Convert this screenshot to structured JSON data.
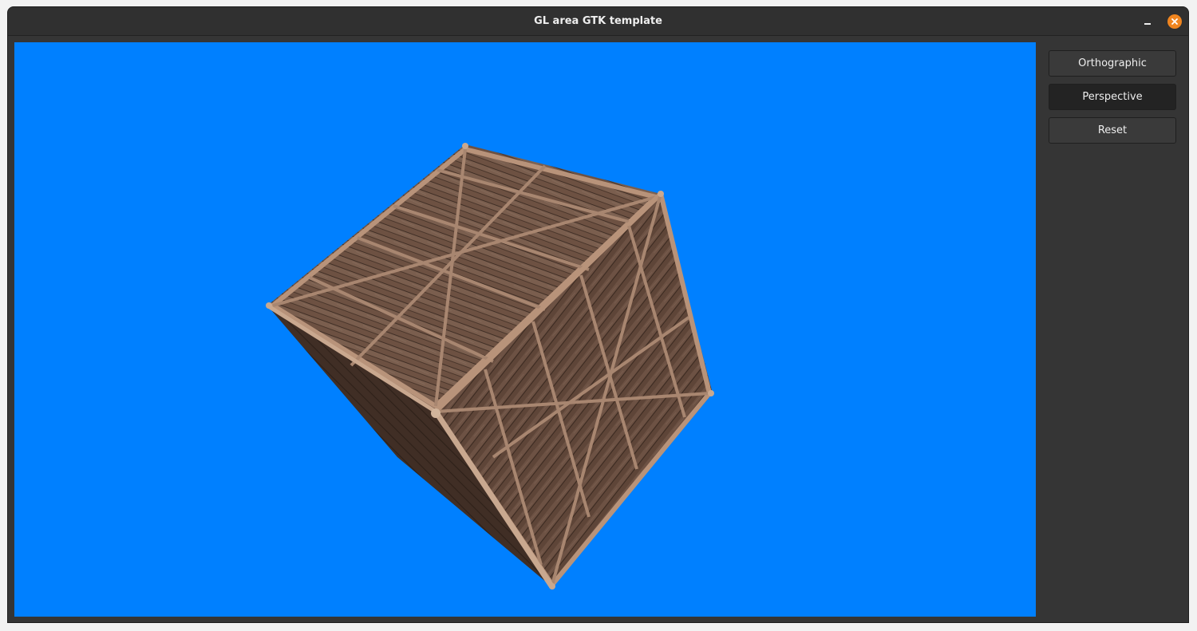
{
  "window": {
    "title": "GL area GTK template"
  },
  "controls": {
    "orthographic_label": "Orthographic",
    "perspective_label": "Perspective",
    "reset_label": "Reset",
    "active_projection": "Perspective"
  },
  "viewport": {
    "clear_color": "#0080ff",
    "object": "wooden-crate-cube"
  },
  "icons": {
    "minimize": "minimize-icon",
    "close": "close-icon"
  },
  "colors": {
    "close_button": "#f0851f",
    "panel_bg": "#353535"
  }
}
